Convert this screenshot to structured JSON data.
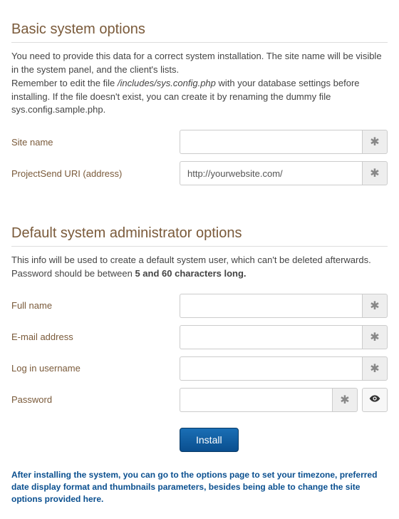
{
  "section1": {
    "title": "Basic system options",
    "desc_part1": "You need to provide this data for a correct system installation. The site name will be visible in the system panel, and the client's lists.",
    "desc_part2a": "Remember to edit the file ",
    "desc_part2_italic": "/includes/sys.config.php",
    "desc_part2b": " with your database settings before installing. If the file doesn't exist, you can create it by renaming the dummy file sys.config.sample.php.",
    "fields": {
      "site_name": {
        "label": "Site name",
        "value": ""
      },
      "uri": {
        "label": "ProjectSend URI (address)",
        "value": "http://yourwebsite.com/"
      }
    }
  },
  "section2": {
    "title": "Default system administrator options",
    "desc_a": "This info will be used to create a default system user, which can't be deleted afterwards. Password should be between ",
    "desc_bold": "5 and 60 characters long.",
    "fields": {
      "full_name": {
        "label": "Full name",
        "value": ""
      },
      "email": {
        "label": "E-mail address",
        "value": ""
      },
      "username": {
        "label": "Log in username",
        "value": ""
      },
      "password": {
        "label": "Password",
        "value": ""
      }
    }
  },
  "required_marker": "✱",
  "install_label": "Install",
  "footer_note": "After installing the system, you can go to the options page to set your timezone, preferred date display format and thumbnails parameters, besides being able to change the site options provided here."
}
